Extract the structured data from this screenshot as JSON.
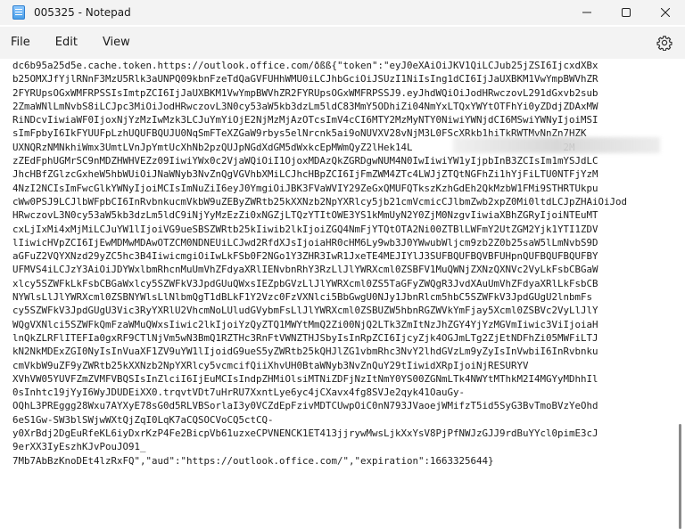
{
  "window": {
    "title": "005325 - Notepad",
    "minimize_glyph": "—",
    "maximize_glyph": "☐",
    "close_glyph": "✕"
  },
  "menu": {
    "items": [
      "File",
      "Edit",
      "View"
    ]
  },
  "editor": {
    "lines": [
      "dc6b95a25d5e.cache.token.https://outlook.office.com/ðßß{\"token\":\"eyJ0eXAiOiJKV1QiLCJub25jZSI6IjcxdXBx",
      "b25OMXJfYjlRNnF3MzU5Rlk3aUNPQ09kbnFzeTdQaGVFUHhWMU0iLCJhbGciOiJSUzI1NiIsIng1dCI6IjJaUXBKM1VwYmpBWVhZR",
      "2FYRUpsOGxWMFRPSSIsImtpZCI6IjJaUXBKM1VwYmpBWVhZR2FYRUpsOGxWMFRPSSJ9.eyJhdWQiOiJodHRwczovL291dGxvb2sub",
      "2ZmaWNlLmNvbS8iLCJpc3MiOiJodHRwczovL3N0cy53aW5kb3dzLm5ldC83MmY5ODhiZi04NmYxLTQxYWYtOTFhYi0yZDdjZDAxMW",
      "RiNDcvIiwiaWF0IjoxNjYzMzIwMzk3LCJuYmYiOjE2NjMzMjAzOTcsImV4cCI6MTY2MzMyNTY0NiwiYWNjdCI6MSwiYWNyIjoiMSI",
      "sImFpbyI6IkFYUUFpLzhUQUFBQUJU0NqSmFTeXZGaW9rbys5elNrcnk5ai9oNUVXV28vNjM3L0FScXRkb1hiTkRWTMvNnZn7HZK",
      "UXNQRzNMNkhiWmx3UmtLVnJpYmtUcXhNb2pzQUJpNGdXdGM5dWxkcEpMWmQyZ2lHek14L                          2M",
      "zZEdFphUGMrSC9nMDZHWHVEZz09IiwiYWx0c2VjaWQiOiI1OjoxMDAzQkZGRDgwNUM4N0IwIiwiYW1yIjpbInB3ZCIsIm1mYSJdLC",
      "JhcHBfZGlzcGxheW5hbWUiOiJNaWNyb3NvZnQgVGVhbXMiLCJhcHBpZCI6IjFmZWM4ZTc4LWJjZTQtNGFhZi1hYjFiLTU0NTFjYzM",
      "4NzI2NCIsImFwcGlkYWNyIjoiMCIsImNuZiI6eyJ0YmgiOiJBK3FVaWVIY29ZeGxQMUFQTkszKzhGdEh2QkMzbW1FMi9STHRTUkpu",
      "cWw0PSJ9LCJlbWFpbCI6InRvbnkucmVkbW9uZEByZWRtb25kXXNzb2NpYXRlcy5jb21cmVcmicCJlbmZwb2xpZ0Mi0ltdLCJpZHAiOiJod",
      "HRwczovL3N0cy53aW5kb3dzLm5ldC9iNjYyMzEzZi0xNGZjLTQzYTItOWE3YS1kMmUyN2Y0ZjM0NzgvIiwiaXBhZGRyIjoiNTEuMT",
      "cxLjIxMi4xMjMiLCJuYW1lIjoiVG9ueSBSZWRtb25kIiwib2lkIjoiZGQ4NmFjYTQtOTA2Ni00ZTBlLWFmY2UtZGM2Yjk1YTI1ZDV",
      "lIiwicHVpZCI6IjEwMDMwMDAwOTZCM0NDNEUiLCJwd2RfdXJsIjoiaHR0cHM6Ly9wb3J0YWwubWljcm9zb2Z0b25saW5lLmNvbS9D",
      "aGFuZ2VQYXNzd29yZC5hc3B4IiwicmgiOiIwLkFSb0F2NGo1Y3ZHR3IwR1JxeTE4MEJIYlJ3SUFBQUFBQVBFUHpnQUFBQUFBQUFBY",
      "UFMVS4iLCJzY3AiOiJDYWxlbmRhcnMuUmVhZFdyaXRlIENvbnRhY3RzLlJlYWRXcml0ZSBFV1MuQWNjZXNzQXNVc2VyLkFsbCBGaW",
      "xlcy5SZWFkLkFsbCBGaWxlcy5SZWFkV3JpdGUuQWxsIEZpbGVzLlJlYWRXcml0ZS5TaGFyZWQgR3JvdXAuUmVhZFdyaXRlLkFsbCB",
      "NYWlsLlJlYWRXcml0ZSBNYWlsLlNlbmQgT1dBLkF1Y2Vzc0FzVXNlci5BbGwgU0NJy1JbnRlcm5hbC5SZWFkV3JpdGUgU2lnbmFs",
      "cy5SZWFkV3JpdGUgU3Vic3RyYXRlU2VhcmNoLUludGVybmFsLlJlYWRXcml0ZSBUZW5hbnRGZWVkYmFjay5Xcml0ZSBVc2VyLlJlY",
      "WQgVXNlci5SZWFkQmFzaWMuQWxsIiwic2lkIjoiYzQyZTQ1MWYtMmQ2Zi00NjQ2LTk3ZmItNzJhZGY4YjYzMGVmIiwic3ViIjoiaH",
      "lnQkZLRFlITEFIa0gxRF9CTlNjVm5wN3BmQ1RZTHc3RnFtVWNZTHJSbyIsInRpZCI6IjcyZjk4OGJmLTg2ZjEtNDFhZi05MWFiLTJ",
      "kN2NkMDExZGI0NyIsInVuaXF1ZV9uYW1lIjoidG9ueS5yZWRtb25kQHJlZG1vbmRhc3NvY2lhdGVzLm9yZyIsInVwbiI6InRvbnku",
      "cmVkbW9uZF9yZWRtb25kXXNzb2NpYXRlcy5vcmcifQiiXhvUH0BtaWNyb3NvZnQuY29tIiwidXRpIjoiNjRESURYV",
      "XVhVW05YUVFZmZVMFVBQSIsInZlciI6IjEuMCIsIndpZHMiOlsiMTNiZDFjNzItNmY0YS00ZGNmLTk4NWYtMThkM2I4MGYyMDhhIl",
      "0sInhtc19jYyI6WyJDUDEiXX0.trqvtVDt7uHrRU7XxntLye6yc4jCXavx4fg8SVJe2qyk41OauGy-",
      "OQhL3PREggg28Wxu7AYXyE78sG0d5RLVBSorlaI3y0VCZdEpFzivMDTCUwpOiC0nN793JVaoejWMifzT5id5SyG3BvTmoBVzYeOhd",
      "6eS1Gw-SW3blSWjwWXtQjZqI0LqK7aCQSOCVoCQ5ctCQ-",
      "y0XrBdj2DgEuRfeKL6iyDxrKzP4Fe2BicpVb61uzxeCPVNENCK1ET413jjrywMwsLjkXxYsV8PjPfNWJzGJJ9rdBuYYcl0pimE3cJ",
      "9erXX3IyEszhKJvPouJO91_",
      "7Mb7AbBzKnoDEt4lzRxFQ\",\"aud\":\"https://outlook.office.com/\",\"expiration\":1663325644}"
    ]
  }
}
